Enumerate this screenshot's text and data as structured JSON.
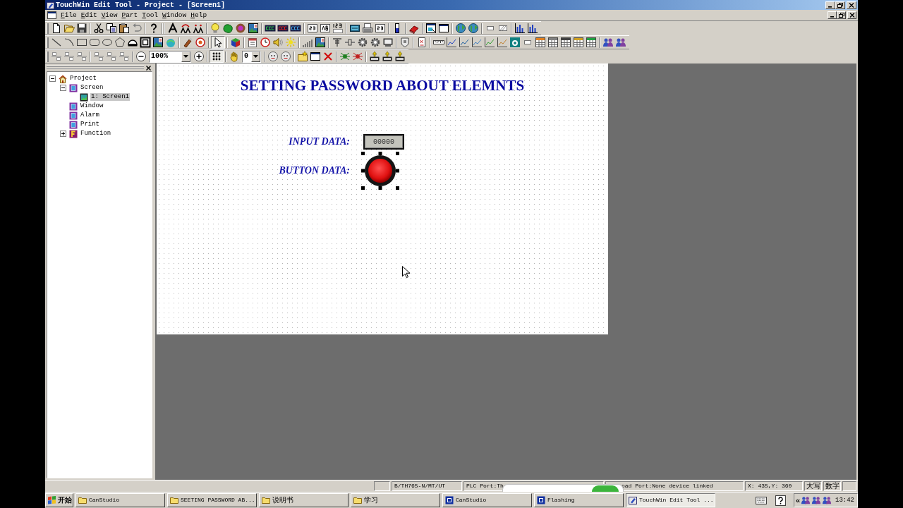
{
  "window": {
    "title": "TouchWin Edit Tool - Project - [Screen1]"
  },
  "menu": [
    "File",
    "Edit",
    "View",
    "Part",
    "Tool",
    "Window",
    "Help"
  ],
  "toolbar": {
    "pointer_tool": {
      "pressed": true
    },
    "grid_toggle": {
      "pressed": true
    },
    "zoom": {
      "value": "100%"
    },
    "layer": {
      "value": "0"
    }
  },
  "project_tree": {
    "items": [
      {
        "label": "Project",
        "kind": "project",
        "selected": false,
        "expanded": true,
        "children": [
          {
            "label": "Screen",
            "kind": "group",
            "selected": false,
            "expanded": true,
            "children": [
              {
                "label": "1: Screen1",
                "kind": "screen",
                "selected": true
              }
            ]
          },
          {
            "label": "Window",
            "kind": "group",
            "selected": false
          },
          {
            "label": "Alarm",
            "kind": "group",
            "selected": false
          },
          {
            "label": "Print",
            "kind": "group",
            "selected": false
          },
          {
            "label": "Function",
            "kind": "function",
            "selected": false,
            "expanded": false
          }
        ]
      }
    ]
  },
  "canvas": {
    "title": "SETTING PASSWORD ABOUT ELEMNTS",
    "parts": [
      {
        "kind": "numeric_input",
        "label": "INPUT DATA:",
        "value": "00000",
        "selected": false
      },
      {
        "kind": "round_button",
        "label": "BUTTON DATA:",
        "selected": true
      }
    ]
  },
  "status_bar": {
    "model": "B/TH765-N/MT/UT",
    "plc_port": "PLC Port:Th",
    "download_port": "oad Port:None device linked",
    "coordinates": "X: 435,Y: 360",
    "caps": "大写",
    "num": "数字"
  },
  "taskbar": {
    "start": "开始",
    "buttons": [
      {
        "label": "CanStudio",
        "kind": "folder",
        "selected": false
      },
      {
        "label": "SEETING PASSWORD AB...",
        "kind": "folder",
        "selected": false
      },
      {
        "label": "说明书",
        "kind": "folder",
        "selected": false
      },
      {
        "label": "学习",
        "kind": "folder",
        "selected": false
      },
      {
        "label": "CanStudio",
        "kind": "window",
        "selected": false
      },
      {
        "label": "Flashing",
        "kind": "window",
        "selected": false
      },
      {
        "label": "TouchWin Edit Tool ...",
        "kind": "touchwin",
        "selected": true
      }
    ],
    "tray_toggle": "«",
    "clock": "13:42"
  }
}
